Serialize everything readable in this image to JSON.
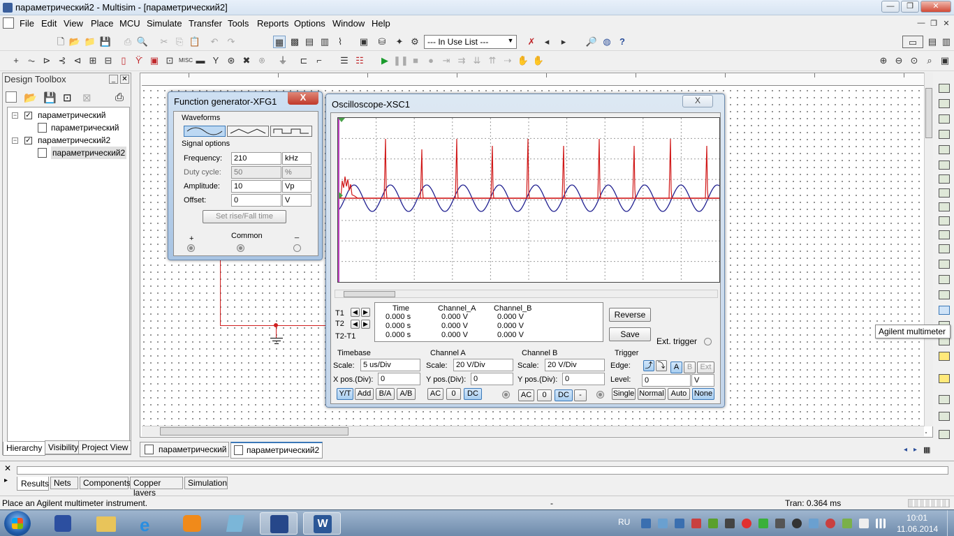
{
  "window": {
    "title": "параметрический2 - Multisim - [параметрический2]"
  },
  "menu": {
    "items": [
      "File",
      "Edit",
      "View",
      "Place",
      "MCU",
      "Simulate",
      "Transfer",
      "Tools",
      "Reports",
      "Options",
      "Window",
      "Help"
    ]
  },
  "toolbar": {
    "in_use_list": "--- In Use List ---"
  },
  "design_toolbox": {
    "title": "Design Toolbox",
    "tree": [
      {
        "label": "параметрический",
        "level": 0
      },
      {
        "label": "параметрический",
        "level": 1
      },
      {
        "label": "параметрический2",
        "level": 0
      },
      {
        "label": "параметрический2",
        "level": 1
      }
    ],
    "tabs": [
      "Hierarchy",
      "Visibility",
      "Project View"
    ]
  },
  "sheet_tabs": [
    "параметрический",
    "параметрический2"
  ],
  "function_generator": {
    "title": "Function generator-XFG1",
    "close_label": "X",
    "waveforms_label": "Waveforms",
    "signal_options_label": "Signal options",
    "frequency": {
      "label": "Frequency:",
      "value": "210",
      "unit": "kHz"
    },
    "duty_cycle": {
      "label": "Duty cycle:",
      "value": "50",
      "unit": "%"
    },
    "amplitude": {
      "label": "Amplitude:",
      "value": "10",
      "unit": "Vp"
    },
    "offset": {
      "label": "Offset:",
      "value": "0",
      "unit": "V"
    },
    "set_rise_fall": "Set rise/Fall time",
    "plus": "+",
    "common": "Common",
    "minus": "_"
  },
  "oscilloscope": {
    "title": "Oscilloscope-XSC1",
    "close_label": "X",
    "measure": {
      "headers": [
        "Time",
        "Channel_A",
        "Channel_B"
      ],
      "rows": [
        {
          "label": "T1",
          "values": [
            "0.000 s",
            "0.000 V",
            "0.000 V"
          ]
        },
        {
          "label": "T2",
          "values": [
            "0.000 s",
            "0.000 V",
            "0.000 V"
          ]
        },
        {
          "label": "T2-T1",
          "values": [
            "0.000 s",
            "0.000 V",
            "0.000 V"
          ]
        }
      ]
    },
    "reverse": "Reverse",
    "save": "Save",
    "ext_trigger": "Ext. trigger",
    "timebase": {
      "title": "Timebase",
      "scale_label": "Scale:",
      "scale": "5 us/Div",
      "xpos_label": "X pos.(Div):",
      "xpos": "0",
      "buttons": [
        "Y/T",
        "Add",
        "B/A",
        "A/B"
      ]
    },
    "channel_a": {
      "title": "Channel A",
      "scale_label": "Scale:",
      "scale": "20  V/Div",
      "ypos_label": "Y pos.(Div):",
      "ypos": "0",
      "buttons": [
        "AC",
        "0",
        "DC"
      ]
    },
    "channel_b": {
      "title": "Channel B",
      "scale_label": "Scale:",
      "scale": "20  V/Div",
      "ypos_label": "Y pos.(Div):",
      "ypos": "0",
      "buttons": [
        "AC",
        "0",
        "DC",
        "-"
      ]
    },
    "trigger": {
      "title": "Trigger",
      "edge_label": "Edge:",
      "level_label": "Level:",
      "level": "0",
      "level_unit": "V",
      "edge_buttons": [
        "A",
        "B",
        "Ext"
      ],
      "mode_buttons": [
        "Single",
        "Normal",
        "Auto",
        "None"
      ]
    },
    "traces": {
      "channel_a_color": "#d01818",
      "channel_b_color": "#202090"
    }
  },
  "tooltip": "Agilent multimeter",
  "spreadsheet": {
    "tabs": [
      "Results",
      "Nets",
      "Components",
      "Copper layers",
      "Simulation"
    ]
  },
  "status": {
    "message": "Place an Agilent multimeter instrument.",
    "middle": "-",
    "tran": "Tran: 0.364 ms"
  },
  "taskbar": {
    "lang": "RU",
    "time": "10:01",
    "date": "11.06.2014"
  },
  "colors": {
    "wire": "#d02020",
    "accent": "#3a78b8"
  }
}
